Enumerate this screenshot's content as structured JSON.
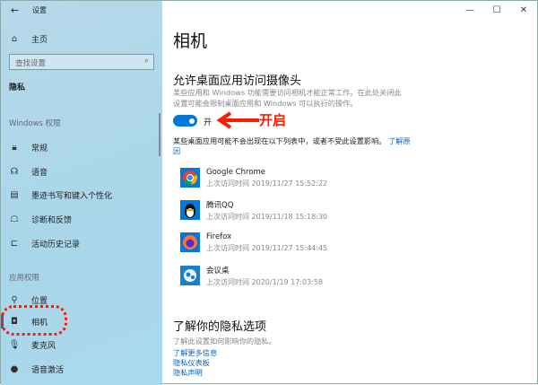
{
  "window": {
    "title": "设置",
    "back_icon": "back-arrow-icon"
  },
  "sidebar": {
    "home": "主页",
    "search_placeholder": "查找设置",
    "section": "隐私",
    "group1": "Windows 权限",
    "items1": [
      {
        "label": "常规",
        "icon": "lock-icon"
      },
      {
        "label": "语音",
        "icon": "speech-icon"
      },
      {
        "label": "墨迹书写和键入个性化",
        "icon": "clipboard-icon"
      },
      {
        "label": "诊断和反馈",
        "icon": "feedback-icon"
      },
      {
        "label": "活动历史记录",
        "icon": "timeline-icon"
      }
    ],
    "group2": "应用权限",
    "items2": [
      {
        "label": "位置",
        "icon": "location-icon"
      },
      {
        "label": "相机",
        "icon": "camera-icon",
        "active": true
      },
      {
        "label": "麦克风",
        "icon": "microphone-icon"
      },
      {
        "label": "语音激活",
        "icon": "voice-activation-icon"
      }
    ]
  },
  "main": {
    "title": "相机",
    "section_title": "允许桌面应用访问摄像头",
    "section_desc": "某些应用和 Windows 功能需要访问相机才能正常工作。在此处关闭此设置可能会限制桌面应用和 Windows 可以执行的操作。",
    "toggle": {
      "state": "on",
      "label": "开"
    },
    "note": "某些桌面应用可能不会出现在以下列表中，或者不受此设置影响。",
    "note_link": "了解原因",
    "apps": [
      {
        "name": "Google Chrome",
        "time": "上次访问时间 2019/11/27 15:52:22"
      },
      {
        "name": "腾讯QQ",
        "time": "上次访问时间 2019/11/18 15:18:30"
      },
      {
        "name": "Firefox",
        "time": "上次访问时间 2019/11/27 15:44:45"
      },
      {
        "name": "会议桌",
        "time": "上次访问时间 2020/1/19 17:03:58"
      }
    ],
    "privacy_title": "了解你的隐私选项",
    "privacy_desc": "了解此设置如何影响你的隐私。",
    "links": [
      "了解更多信息",
      "隐私仪表板",
      "隐私声明"
    ]
  },
  "annotation": {
    "text": "开启",
    "color": "#ff1a00"
  }
}
